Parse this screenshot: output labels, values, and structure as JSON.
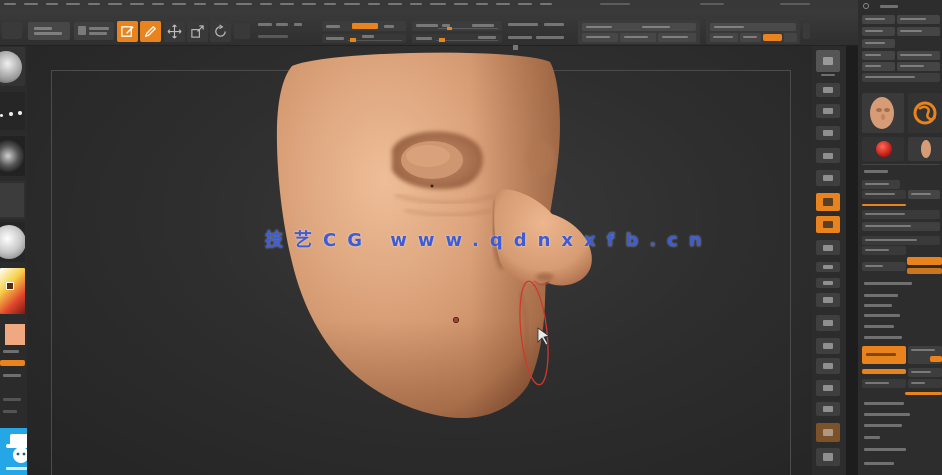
{
  "watermark": {
    "text": "技艺CG www.qdnxxfb.cn"
  },
  "colors": {
    "accent": "#e8831d",
    "panel": "#2d2d2d",
    "canvas": "#2e2e2e",
    "skin": "#d9a078",
    "brush_ring": "#d0382a",
    "watermark": "#3d5cd8",
    "logo": "#25a6e6"
  },
  "icons": {
    "toolbar": [
      "edit-icon",
      "draw-icon",
      "move-icon",
      "scale-icon",
      "rotate-icon"
    ],
    "tool_palette": [
      "head-thumbnail-icon",
      "polymesh-icon",
      "sphere-icon"
    ],
    "left_shelf": [
      "brush-icon",
      "stroke-icon",
      "alpha-icon",
      "texture-icon",
      "material-icon",
      "color-picker-icon"
    ]
  }
}
